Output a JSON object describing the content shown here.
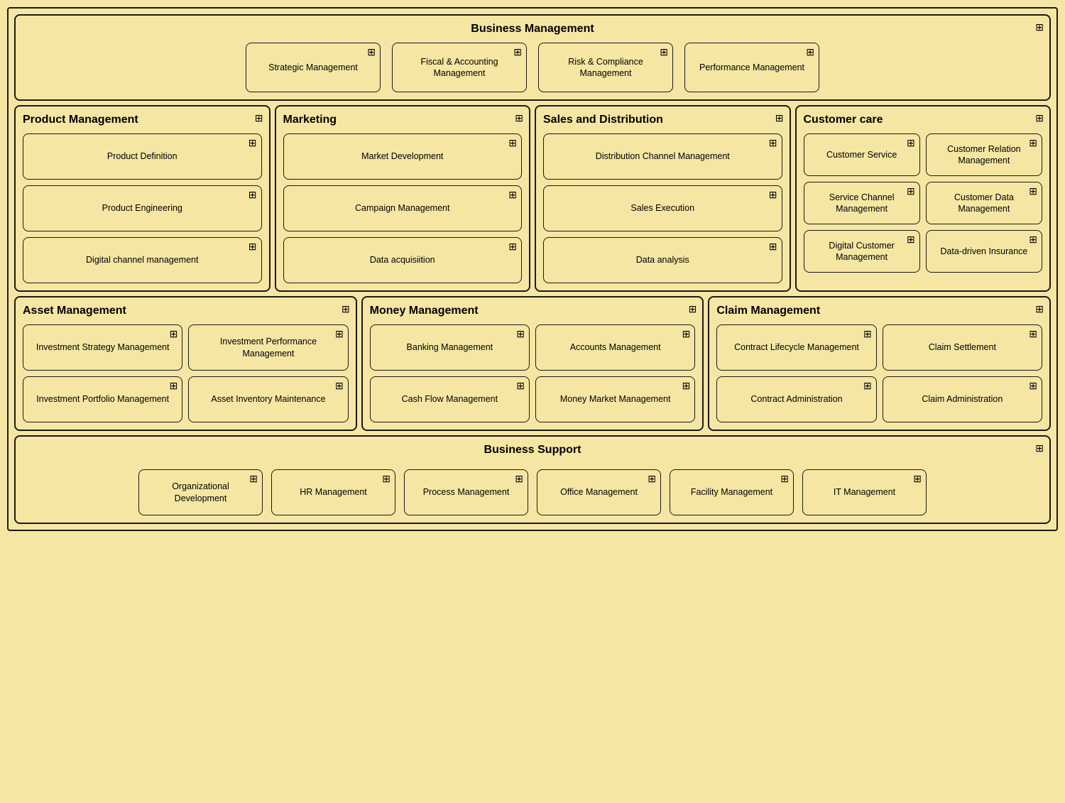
{
  "businessManagement": {
    "title": "Business Management",
    "cards": [
      {
        "label": "Strategic Management"
      },
      {
        "label": "Fiscal & Accounting Management"
      },
      {
        "label": "Risk & Compliance Management"
      },
      {
        "label": "Performance Management"
      }
    ]
  },
  "productManagement": {
    "title": "Product Management",
    "cards": [
      {
        "label": "Product Definition"
      },
      {
        "label": "Product Engineering"
      },
      {
        "label": "Digital channel management"
      }
    ]
  },
  "marketing": {
    "title": "Marketing",
    "cards": [
      {
        "label": "Market Development"
      },
      {
        "label": "Campaign Management"
      },
      {
        "label": "Data acquisiition"
      }
    ]
  },
  "salesDistribution": {
    "title": "Sales and Distribution",
    "cards": [
      {
        "label": "Distribution Channel Management"
      },
      {
        "label": "Sales Execution"
      },
      {
        "label": "Data analysis"
      }
    ]
  },
  "customerCare": {
    "title": "Customer care",
    "cards": [
      {
        "label": "Customer Service"
      },
      {
        "label": "Customer Relation Management"
      },
      {
        "label": "Service Channel Management"
      },
      {
        "label": "Customer Data Management"
      },
      {
        "label": "Digital Customer Management"
      },
      {
        "label": "Data-driven Insurance"
      }
    ]
  },
  "assetManagement": {
    "title": "Asset Management",
    "cards": [
      {
        "label": "Investment Strategy Management"
      },
      {
        "label": "Investment Performance Management"
      },
      {
        "label": "Investment Portfolio Management"
      },
      {
        "label": "Asset Inventory Maintenance"
      }
    ]
  },
  "moneyManagement": {
    "title": "Money Management",
    "cards": [
      {
        "label": "Banking Management"
      },
      {
        "label": "Accounts Management"
      },
      {
        "label": "Cash Flow Management"
      },
      {
        "label": "Money Market Management"
      }
    ]
  },
  "claimManagement": {
    "title": "Claim Management",
    "cards": [
      {
        "label": "Contract Lifecycle Management"
      },
      {
        "label": "Claim Settlement"
      },
      {
        "label": "Contract Administration"
      },
      {
        "label": "Claim Administration"
      }
    ]
  },
  "businessSupport": {
    "title": "Business Support",
    "cards": [
      {
        "label": "Organizational Development"
      },
      {
        "label": "HR Management"
      },
      {
        "label": "Process Management"
      },
      {
        "label": "Office Management"
      },
      {
        "label": "Facility Management"
      },
      {
        "label": "IT Management"
      }
    ]
  }
}
